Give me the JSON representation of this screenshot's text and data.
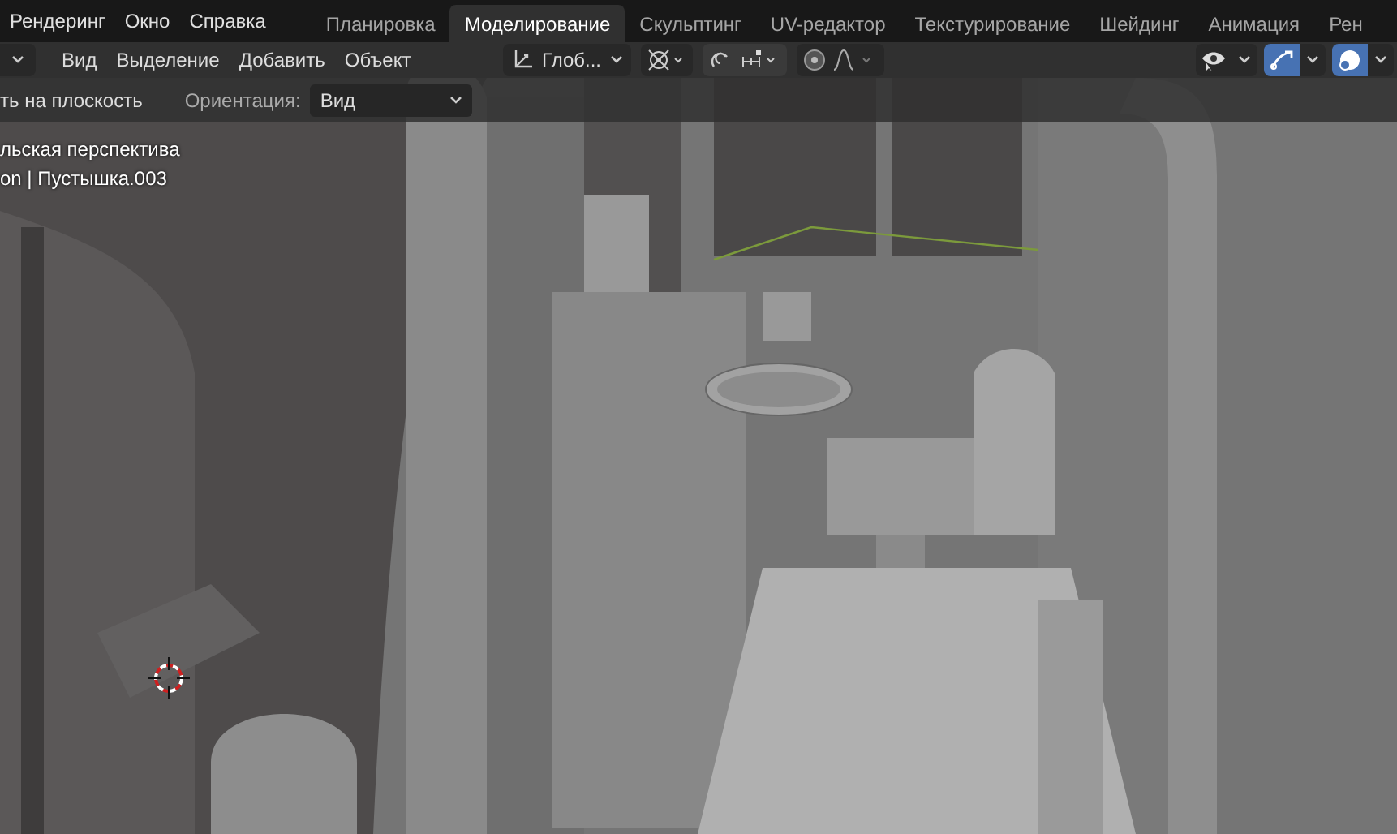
{
  "menu": [
    "Рендеринг",
    "Окно",
    "Справка"
  ],
  "workspaces": [
    {
      "label": "Планировка",
      "selected": false
    },
    {
      "label": "Моделирование",
      "selected": true
    },
    {
      "label": "Скульптинг",
      "selected": false
    },
    {
      "label": "UV-редактор",
      "selected": false
    },
    {
      "label": "Текстурирование",
      "selected": false
    },
    {
      "label": "Шейдинг",
      "selected": false
    },
    {
      "label": "Анимация",
      "selected": false
    },
    {
      "label": "Рен",
      "selected": false
    }
  ],
  "header_menu": [
    "Вид",
    "Выделение",
    "Добавить",
    "Объект"
  ],
  "transform_orientation": "Глоб...",
  "viewport_toggles": [
    {
      "kind": "visibility",
      "active": false
    },
    {
      "kind": "gizmo",
      "active": true
    },
    {
      "kind": "overlay",
      "active": true
    }
  ],
  "tool_settings": {
    "partial_label": "ть на плоскость",
    "orientation_label": "Ориентация:",
    "orientation_value": "Вид"
  },
  "viewport_info": [
    "льская перспектива",
    "on | Пустышка.003"
  ]
}
